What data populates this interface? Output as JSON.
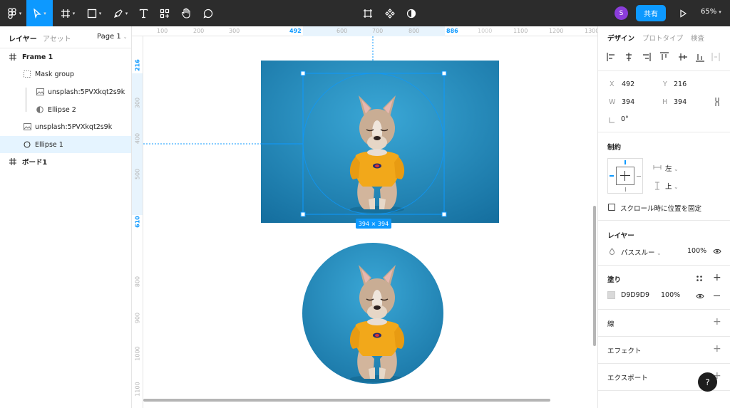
{
  "toolbar": {
    "share_label": "共有",
    "avatar_initial": "S",
    "zoom": "65%"
  },
  "left_panel": {
    "tabs": [
      "レイヤー",
      "アセット"
    ],
    "page": "Page 1",
    "layers": [
      {
        "name": "Frame 1",
        "icon": "frame-icon"
      },
      {
        "name": "Mask group",
        "icon": "mask-group-icon"
      },
      {
        "name": "unsplash:5PVXkqt2s9k",
        "icon": "image-icon"
      },
      {
        "name": "Ellipse 2",
        "icon": "mask-icon"
      },
      {
        "name": "unsplash:5PVXkqt2s9k",
        "icon": "image-icon"
      },
      {
        "name": "Ellipse 1",
        "icon": "ellipse-icon"
      },
      {
        "name": "ボード1",
        "icon": "frame-icon"
      }
    ]
  },
  "rulers": {
    "top": [
      "100",
      "200",
      "300",
      "492",
      "600",
      "700",
      "800",
      "886",
      "1000",
      "1100",
      "1200",
      "1300"
    ],
    "left": [
      "216",
      "300",
      "400",
      "500",
      "610",
      "800",
      "900",
      "1000",
      "1100"
    ]
  },
  "canvas": {
    "size_badge": "394 × 394"
  },
  "right_panel": {
    "tabs": [
      "デザイン",
      "プロトタイプ",
      "検査"
    ],
    "x_label": "X",
    "x_value": "492",
    "y_label": "Y",
    "y_value": "216",
    "w_label": "W",
    "w_value": "394",
    "h_label": "H",
    "h_value": "394",
    "rotation": "0°",
    "constraints_title": "制約",
    "constraint_h": "左",
    "constraint_v": "上",
    "fix_scroll_label": "スクロール時に位置を固定",
    "layer_title": "レイヤー",
    "blend_mode": "パススルー",
    "layer_opacity": "100%",
    "fill_title": "塗り",
    "fill_hex": "D9D9D9",
    "fill_opacity": "100%",
    "fill_color": "#d9d9d9",
    "stroke_title": "線",
    "effect_title": "エフェクト",
    "export_title": "エクスポート",
    "help": "?"
  },
  "colors": {
    "accent": "#0d99ff",
    "photo_bg": "#1a86b8"
  }
}
